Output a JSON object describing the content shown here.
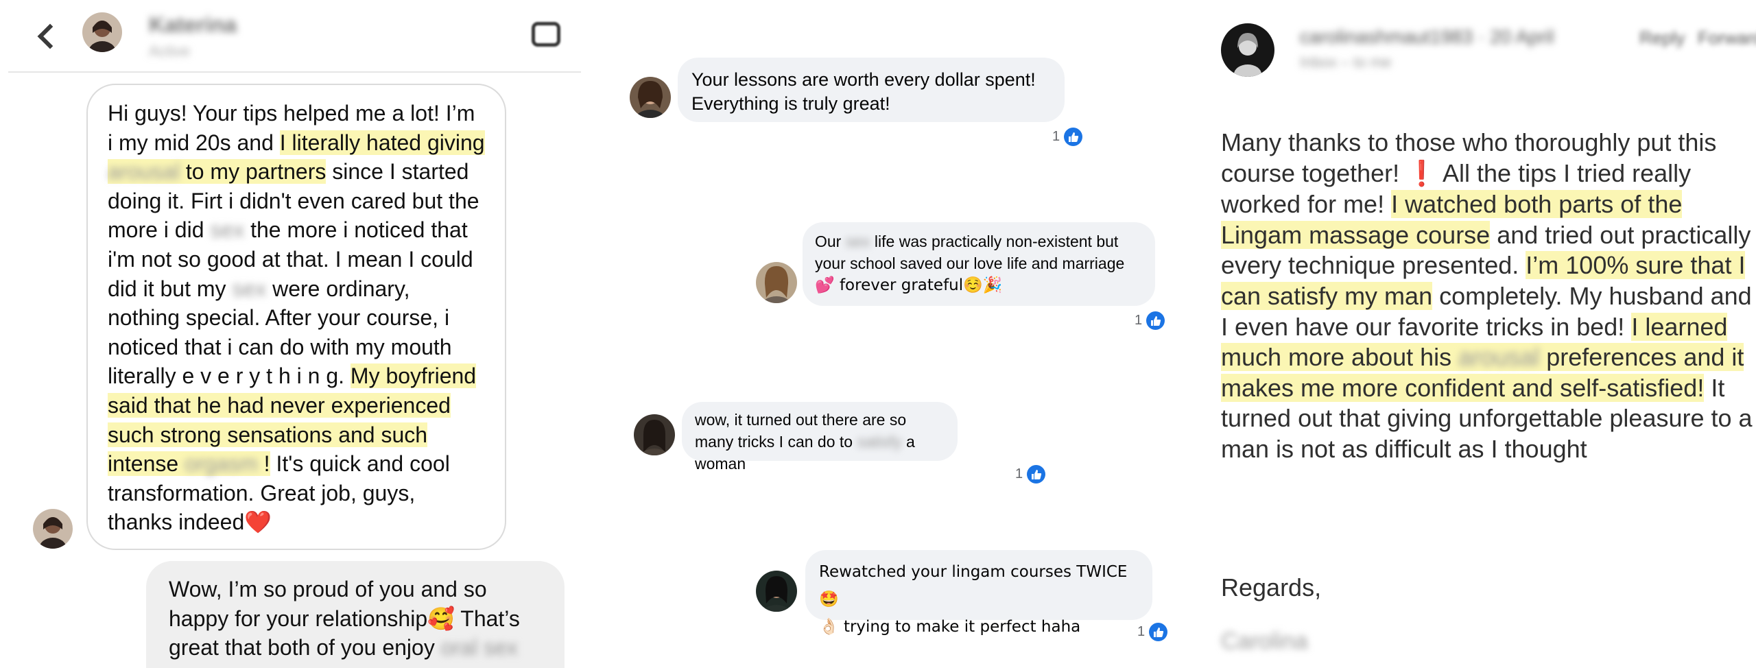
{
  "left": {
    "contact_name": "Katerina",
    "contact_status": "Active",
    "message": {
      "t1": "Hi guys! Your tips helped me a lot! I’m i my mid 20s and ",
      "h1": "I literally hated giving ",
      "m1": "arousal",
      "h2": " to my partners",
      "t2": " since I started doing it. Firt i didn't even cared but the more i did ",
      "m2": "sex",
      "t3": " the more i noticed that i'm not so good at that. I mean I could did it but my ",
      "m3": "sex",
      "t4": " were ordinary, nothing special. After your course, i noticed that i can do with my mouth literally e v e r y t h i n g. ",
      "h3": "My boyfriend said that he had never experienced such strong sensations and such intense ",
      "m4": "orgasm",
      "h4": " !",
      "t5": " It's quick and cool transformation. Great job, guys, thanks indeed",
      "heart": "❤️"
    },
    "reply": {
      "t1": "Wow, I’m so proud of you and so happy for your relationship",
      "emoji": "🥰",
      "t2": " That’s great that both of you enjoy ",
      "m1": "oral sex"
    }
  },
  "middle": {
    "comments": [
      {
        "text": "Your lessons are worth every dollar spent! Everything is truly great!",
        "likes": "1"
      },
      {
        "t1": "Our ",
        "m1": "sex",
        "t2": " life was practically non-existent but your school saved our love life and marriage",
        "line2": "💕 forever grateful☺️🎉",
        "likes": "1"
      },
      {
        "t1": "wow, it turned out there are so many tricks I can do to ",
        "m1": "satisfy",
        "t2": " a woman",
        "likes": "1"
      },
      {
        "t1": "Rewatched your lingam courses TWICE🤩",
        "t2": "👌🏻 trying to make it perfect haha",
        "likes": "1"
      }
    ]
  },
  "right": {
    "sender_name": "carolinashmaut1983",
    "sender_date": "20 April",
    "sender_sub": "Inbox – to me",
    "actions": [
      "Reply",
      "Forward"
    ],
    "body": {
      "t1": "Many thanks to those who thoroughly put this course together! ",
      "mark": "❗",
      "t2": "  All the tips I tried really worked for me! ",
      "h1": "I watched both parts of the Lingam massage course",
      "t3": " and tried out practically every technique presented. ",
      "h2": "I’m 100% sure that I can satisfy my man",
      "t4": " completely. My husband and I even have our favorite tricks in bed! ",
      "h3a": "I learned much more about his ",
      "m1": "arousal",
      "h3b": " preferences and it makes me more confident and self-satisfied!",
      "t5": " It turned out that giving unforgettable pleasure to a man is not as difficult as I thought"
    },
    "regards": "Regards,",
    "signature": "Carolina"
  },
  "colors": {
    "highlight": "#fbf6b4",
    "facebook_blue": "#1b74e4",
    "bubble_gray": "#f0f2f5"
  }
}
